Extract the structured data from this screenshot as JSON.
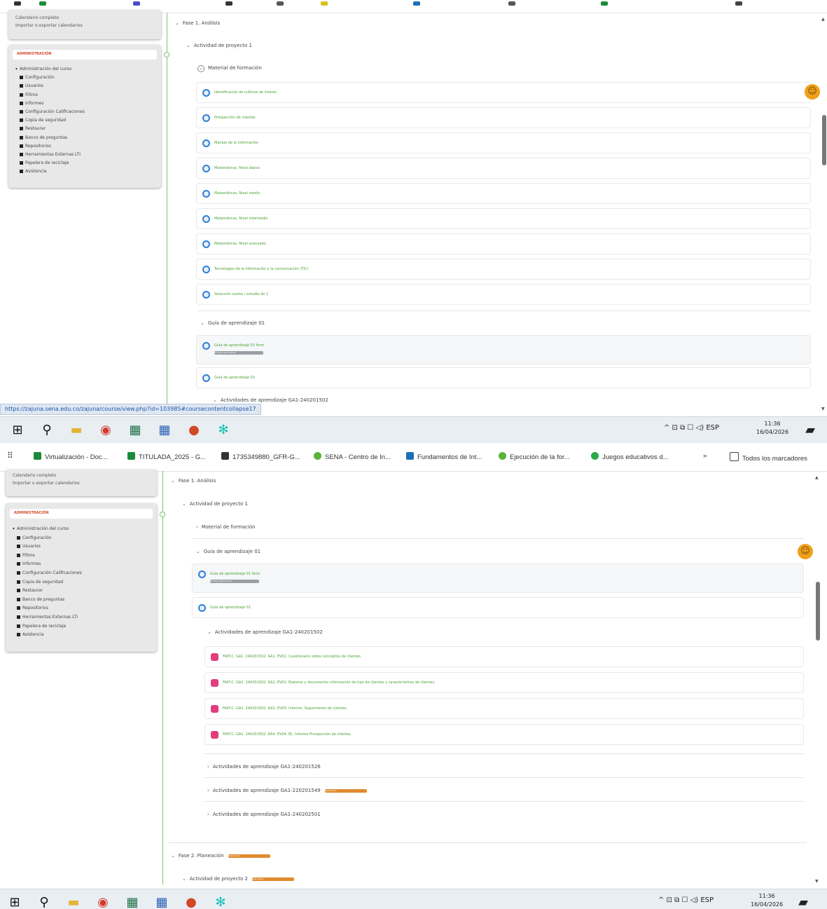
{
  "status_url": "https://zajuna.sena.edu.co/zajuna/course/view.php?id=103985#coursecontentcollapse17",
  "sidebar": {
    "top_links": [
      "Calendario completo",
      "Importar o exportar calendarios"
    ],
    "admin_header": "ADMINISTRACIÓN",
    "admin_items": [
      "Administración del curso",
      "Configuración",
      "Usuarios",
      "Filtros",
      "Informes",
      "Configuración Calificaciones",
      "Copia de seguridad",
      "Restaurar",
      "Banco de preguntas",
      "Repositorios",
      "Herramientas Externas LTI",
      "Papelera de reciclaje",
      "Asistencia"
    ]
  },
  "shot1": {
    "fase": "Fase 1. Análisis",
    "actividad": "Actividad de proyecto 1",
    "material": "Material de formación",
    "materials": [
      "Identificación de cultivos de interés",
      "Prospección de clientes",
      "Manejo de la información",
      "Matemáticas. Nivel básico",
      "Matemáticas. Nivel medio",
      "Matemáticas. Nivel intermedio",
      "Matemáticas. Nivel avanzado",
      "Tecnologías de la información y la comunicación (TIC)",
      "Selección suelos / estudio de 1"
    ],
    "guia_section": "Guía de aprendizaje 01",
    "guia_items": [
      "Guía de aprendizaje 01 form",
      "Guía de aprendizaje 01"
    ],
    "guia_badge": "No hay restricciones",
    "next_section": "Actividades de aprendizaje GA1-240201502"
  },
  "bookmarks": [
    "Virtualización - Doc...",
    "TITULADA_2025 - G...",
    "1735349880_GFR-G...",
    "SENA - Centro de In...",
    "Fundamentos de Int...",
    "Ejecución de la for...",
    "Juegos educativos d...",
    "Todos los marcadores"
  ],
  "bookmarks_more": "»",
  "shot2": {
    "fase": "Fase 1. Análisis",
    "actividad": "Actividad de proyecto 1",
    "material": "Material de formación",
    "guia_section": "Guía de aprendizaje 01",
    "guia_items": [
      "Guía de aprendizaje 01 form",
      "Guía de aprendizaje 01"
    ],
    "guia_badge": "No hay restricciones",
    "actividades_section": "Actividades de aprendizaje GA1-240201502",
    "evidencias": [
      "FAPCC. GA1. 240201502. AA1. EV01. Cuestionario sobre conceptos de clientes",
      "FAPCC. GA1. 240201502. AA2. EV02. Elaborar y documentar información de tipo de clientes y características de clientes",
      "FAPCC. GA1. 240201502. AA3. EV03. Informe. Seguimiento de clientes",
      "FAPCC. GA1. 240201502. AA4. EV04. EL. Informe Prospección de clientes"
    ],
    "more_sections": [
      "Actividades de aprendizaje GA1-240201526",
      "Actividades de aprendizaje GA1-220201549",
      "Actividades de aprendizaje GA1-240202501"
    ],
    "restricted_badge": "Restringido",
    "fase2": "Fase 2. Planeación",
    "actividad2": "Actividad de proyecto 2"
  },
  "taskbar": {
    "tray": "^   ⊡  ⧉  ☐  ◁)  ESP",
    "time": "11:36",
    "date": "16/04/2026"
  },
  "colors": {
    "link_green": "#4aa233",
    "timeline_green": "#7dc56b",
    "admin_red": "#d34a2a",
    "resource_blue": "#2f7fd6",
    "assignment_pink": "#e23d7d",
    "restricted_orange": "#e08a2e"
  }
}
